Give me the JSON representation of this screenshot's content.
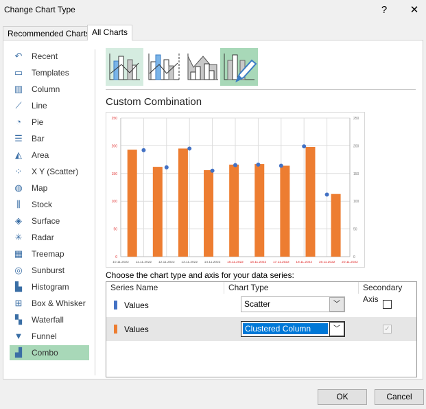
{
  "dialog": {
    "title": "Change Chart Type",
    "help": "?",
    "close": "✕"
  },
  "tabs": [
    {
      "label": "Recommended Charts"
    },
    {
      "label": "All Charts"
    }
  ],
  "sidebar": {
    "items": [
      {
        "label": "Recent",
        "icon": "↶"
      },
      {
        "label": "Templates",
        "icon": "▭"
      },
      {
        "label": "Column",
        "icon": "▥"
      },
      {
        "label": "Line",
        "icon": "⟋"
      },
      {
        "label": "Pie",
        "icon": "◔"
      },
      {
        "label": "Bar",
        "icon": "☰"
      },
      {
        "label": "Area",
        "icon": "◭"
      },
      {
        "label": "X Y (Scatter)",
        "icon": "⁘"
      },
      {
        "label": "Map",
        "icon": "◍"
      },
      {
        "label": "Stock",
        "icon": "⫼"
      },
      {
        "label": "Surface",
        "icon": "◈"
      },
      {
        "label": "Radar",
        "icon": "✳"
      },
      {
        "label": "Treemap",
        "icon": "▦"
      },
      {
        "label": "Sunburst",
        "icon": "◎"
      },
      {
        "label": "Histogram",
        "icon": "▙"
      },
      {
        "label": "Box & Whisker",
        "icon": "⊞"
      },
      {
        "label": "Waterfall",
        "icon": "▚"
      },
      {
        "label": "Funnel",
        "icon": "▼"
      },
      {
        "label": "Combo",
        "icon": "▟"
      }
    ],
    "selected": "Combo"
  },
  "combo_types": [
    "clustered-column-line",
    "clustered-column-line-secondary-axis",
    "stacked-area-clustered-column",
    "custom-combination"
  ],
  "subtitle": "Custom Combination",
  "chart_data": {
    "type": "bar",
    "categories": [
      "10.11.2022",
      "11.11.2022",
      "12.11.2022",
      "13.11.2022",
      "14.11.2022",
      "15.11.2022",
      "16.11.2022",
      "17.11.2022",
      "18.11.2022",
      "19.11.2022",
      "20.11.2022"
    ],
    "series": [
      {
        "type": "bar",
        "color": "#ed7d31",
        "values": [
          193,
          162,
          195,
          156,
          166,
          167,
          164,
          198,
          113
        ]
      },
      {
        "type": "scatter",
        "color": "#4472c4",
        "values": [
          192,
          161,
          195,
          155,
          165,
          166,
          164,
          199,
          112
        ]
      }
    ],
    "y_ticks": [
      "0",
      "50",
      "100",
      "150",
      "200",
      "250"
    ],
    "ylim": [
      0,
      250
    ],
    "grid": true,
    "red_labels_from": "15.11.2022"
  },
  "prompt": "Choose the chart type and axis for your data series:",
  "table": {
    "headers": [
      "Series Name",
      "Chart Type",
      "Secondary Axis"
    ],
    "rows": [
      {
        "name": "Values",
        "color": "#4472c4",
        "chart_type": "Scatter",
        "secondary": false
      },
      {
        "name": "Values",
        "color": "#ed7d31",
        "chart_type": "Clustered Column",
        "secondary": true
      }
    ]
  },
  "buttons": {
    "ok": "OK",
    "cancel": "Cancel"
  }
}
